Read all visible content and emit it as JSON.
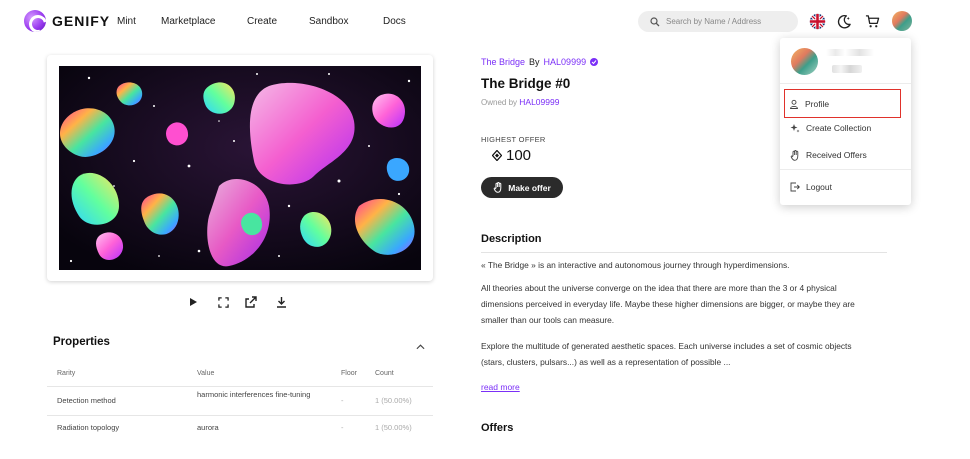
{
  "app": {
    "logo_text": "GENIFY"
  },
  "nav": [
    "Mint",
    "Marketplace",
    "Create",
    "Sandbox",
    "Docs"
  ],
  "search": {
    "placeholder": "Search by Name / Address"
  },
  "header_icons": [
    "uk-flag-icon",
    "moon-icon",
    "cart-icon",
    "avatar"
  ],
  "colors": {
    "accent": "#7b2ff7",
    "button_dark": "#2b2b2b",
    "highlight": "#e0322b"
  },
  "media_controls": [
    "play-icon",
    "fullscreen-icon",
    "open-external-icon",
    "download-icon"
  ],
  "properties": {
    "title": "Properties",
    "columns": [
      "Rarity",
      "Value",
      "Floor",
      "Count"
    ],
    "rows": [
      {
        "rarity": "Detection method",
        "value": "harmonic interferences fine-tuning",
        "floor": "-",
        "count": "1 (50.00%)"
      },
      {
        "rarity": "Radiation topology",
        "value": "aurora",
        "floor": "-",
        "count": "1 (50.00%)"
      }
    ]
  },
  "detail": {
    "collection": "The Bridge",
    "by_label": "By",
    "creator": "HAL09999",
    "title": "The Bridge #0",
    "owned_by_label": "Owned by",
    "owner": "HAL09999",
    "highest_offer_label": "HIGHEST OFFER",
    "highest_offer_value": "100",
    "make_offer_label": "Make offer"
  },
  "description": {
    "title": "Description",
    "paragraphs": [
      "« The Bridge » is an interactive and autonomous journey through hyperdimensions.",
      "All theories about the universe converge on the idea that there are more than the 3 or 4 physical dimensions perceived in everyday life. Maybe these higher dimensions are bigger, or maybe they are smaller than our tools can measure.",
      "Explore the multitude of generated aesthetic spaces. Each universe includes a set of cosmic objects (stars, clusters, pulsars...) as well as a representation of possible ..."
    ],
    "read_more": "read more"
  },
  "offers": {
    "title": "Offers"
  },
  "dropdown": {
    "items": [
      {
        "label": "Profile",
        "icon": "user-icon"
      },
      {
        "label": "Create Collection",
        "icon": "sparkle-icon"
      },
      {
        "label": "Received Offers",
        "icon": "hand-icon"
      },
      {
        "label": "Logout",
        "icon": "logout-icon"
      }
    ]
  }
}
